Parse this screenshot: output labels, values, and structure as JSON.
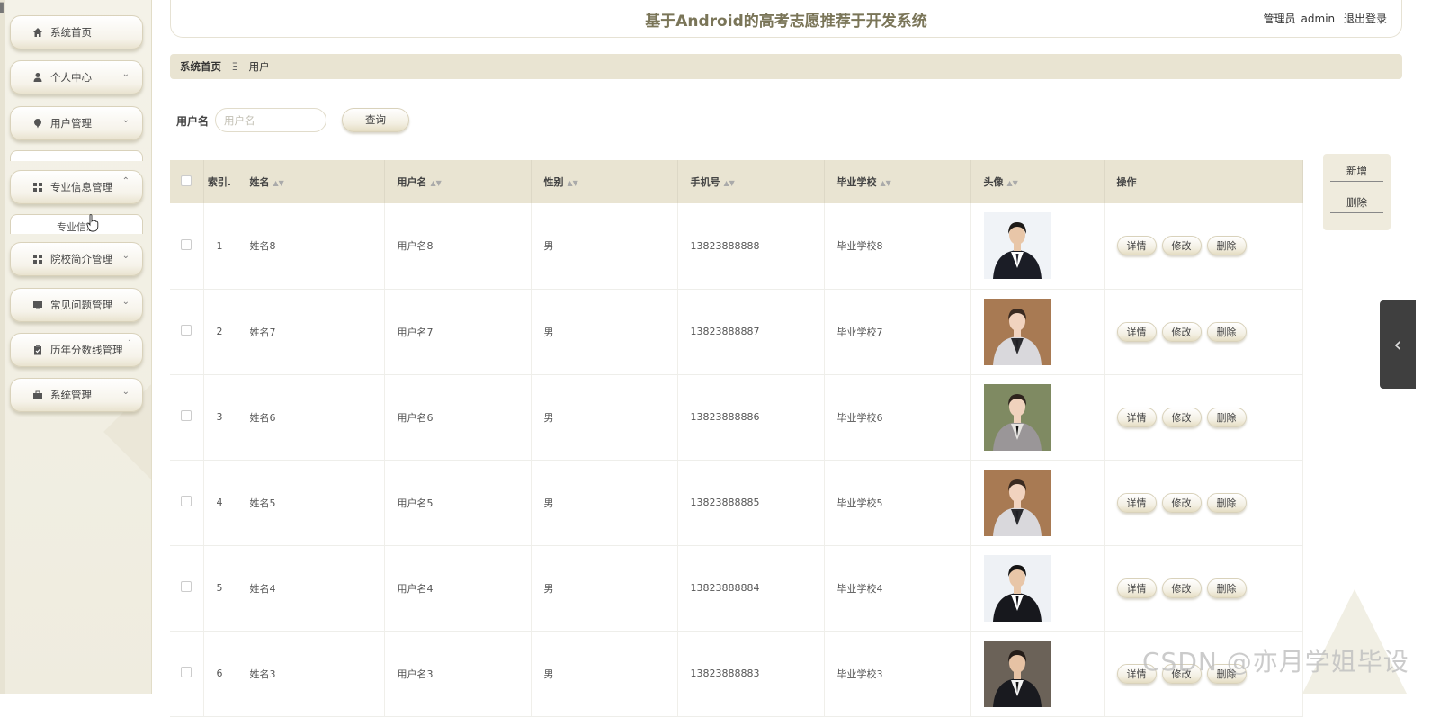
{
  "header": {
    "title": "基于Android的高考志愿推荐于开发系统",
    "role_label": "管理员",
    "username": "admin",
    "logout_label": "退出登录"
  },
  "sidebar": {
    "items": [
      {
        "label": "系统首页",
        "icon": "home-icon"
      },
      {
        "label": "个人中心",
        "icon": "user-icon"
      },
      {
        "label": "用户管理",
        "icon": "pin-icon"
      },
      {
        "label": "专业信息管理",
        "icon": "grid-icon"
      },
      {
        "label": "院校简介管理",
        "icon": "grid-icon"
      },
      {
        "label": "常见问题管理",
        "icon": "monitor-icon"
      },
      {
        "label": "历年分数线管理",
        "icon": "clipboard-icon"
      },
      {
        "label": "系统管理",
        "icon": "briefcase-icon"
      }
    ],
    "submenu_label": "专业信息"
  },
  "breadcrumb": {
    "home": "系统首页",
    "separator": "Ξ",
    "current": "用户"
  },
  "search": {
    "label": "用户名",
    "placeholder": "用户名",
    "value": "",
    "button": "查询"
  },
  "side_actions": {
    "add": "新增",
    "delete": "删除"
  },
  "table": {
    "columns": {
      "index": "索引.",
      "name": "姓名",
      "username": "用户名",
      "gender": "性别",
      "phone": "手机号",
      "school": "毕业学校",
      "avatar": "头像",
      "actions": "操作"
    },
    "action_labels": {
      "detail": "详情",
      "edit": "修改",
      "delete": "删除"
    },
    "rows": [
      {
        "index": "1",
        "name": "姓名8",
        "username": "用户名8",
        "gender": "男",
        "phone": "13823888888",
        "school": "毕业学校8"
      },
      {
        "index": "2",
        "name": "姓名7",
        "username": "用户名7",
        "gender": "男",
        "phone": "13823888887",
        "school": "毕业学校7"
      },
      {
        "index": "3",
        "name": "姓名6",
        "username": "用户名6",
        "gender": "男",
        "phone": "13823888886",
        "school": "毕业学校6"
      },
      {
        "index": "4",
        "name": "姓名5",
        "username": "用户名5",
        "gender": "男",
        "phone": "13823888885",
        "school": "毕业学校5"
      },
      {
        "index": "5",
        "name": "姓名4",
        "username": "用户名4",
        "gender": "男",
        "phone": "13823888884",
        "school": "毕业学校4"
      },
      {
        "index": "6",
        "name": "姓名3",
        "username": "用户名3",
        "gender": "男",
        "phone": "13823888883",
        "school": "毕业学校3"
      }
    ]
  },
  "watermark": "CSDN @亦月学姐毕设",
  "colors": {
    "accent": "#e9e4d2",
    "title": "#7a7558",
    "float_tab": "#3f3f3f"
  }
}
